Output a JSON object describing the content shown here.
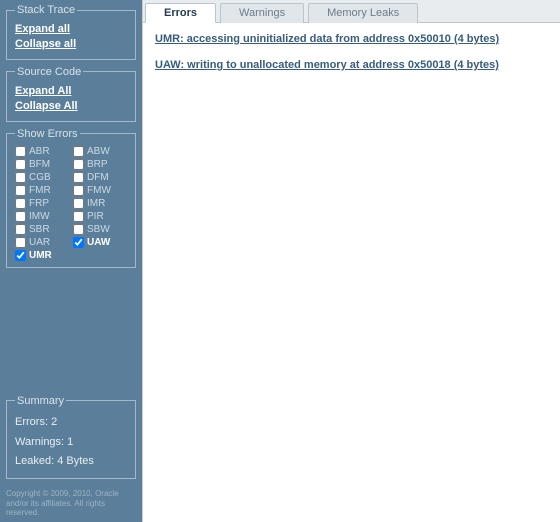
{
  "sidebar": {
    "stackTrace": {
      "legend": "Stack Trace",
      "expand": "Expand all",
      "collapse": "Collapse all"
    },
    "sourceCode": {
      "legend": "Source Code",
      "expand": "Expand All",
      "collapse": "Collapse All"
    },
    "showErrors": {
      "legend": "Show Errors",
      "items": [
        {
          "code": "ABR",
          "checked": false
        },
        {
          "code": "ABW",
          "checked": false
        },
        {
          "code": "BFM",
          "checked": false
        },
        {
          "code": "BRP",
          "checked": false
        },
        {
          "code": "CGB",
          "checked": false
        },
        {
          "code": "DFM",
          "checked": false
        },
        {
          "code": "FMR",
          "checked": false
        },
        {
          "code": "FMW",
          "checked": false
        },
        {
          "code": "FRP",
          "checked": false
        },
        {
          "code": "IMR",
          "checked": false
        },
        {
          "code": "IMW",
          "checked": false
        },
        {
          "code": "PIR",
          "checked": false
        },
        {
          "code": "SBR",
          "checked": false
        },
        {
          "code": "SBW",
          "checked": false
        },
        {
          "code": "UAR",
          "checked": false
        },
        {
          "code": "UAW",
          "checked": true
        },
        {
          "code": "UMR",
          "checked": true
        }
      ]
    },
    "summary": {
      "legend": "Summary",
      "errors_label": "Errors:",
      "errors_value": "2",
      "warnings_label": "Warnings:",
      "warnings_value": "1",
      "leaked_label": "Leaked:",
      "leaked_value": "4 Bytes"
    },
    "copyright": "Copyright © 2009, 2010, Oracle and/or its affiliates. All rights reserved."
  },
  "tabs": {
    "errors": "Errors",
    "warnings": "Warnings",
    "memoryLeaks": "Memory Leaks"
  },
  "messages": [
    {
      "abbr": "UMR",
      "text": "UMR: accessing uninitialized data from address 0x50010 (4 bytes)"
    },
    {
      "abbr": "UAW",
      "text": "UAW: writing to unallocated memory at address 0x50018 (4 bytes)"
    }
  ]
}
